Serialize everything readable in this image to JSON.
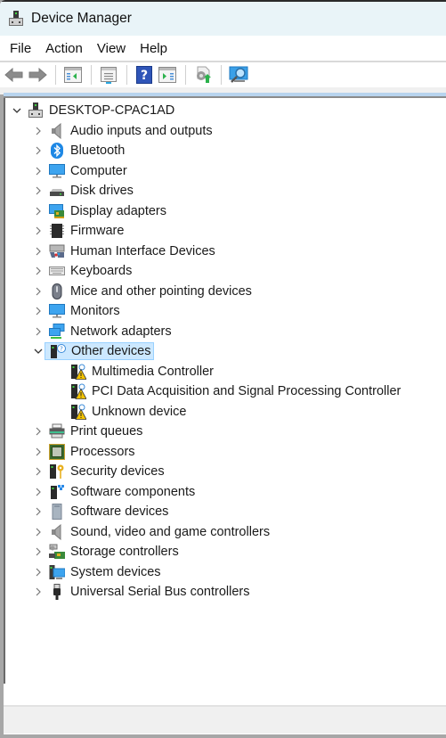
{
  "window": {
    "title": "Device Manager",
    "icon": "device-manager-icon"
  },
  "menu": [
    "File",
    "Action",
    "View",
    "Help"
  ],
  "toolbar": [
    {
      "name": "back-button",
      "icon": "arrow-left-icon"
    },
    {
      "name": "forward-button",
      "icon": "arrow-right-icon"
    },
    {
      "name": "show-hide-console-tree-button",
      "icon": "console-tree-icon"
    },
    {
      "name": "properties-button",
      "icon": "properties-icon"
    },
    {
      "name": "help-button",
      "icon": "help-icon"
    },
    {
      "name": "show-hide-action-pane-button",
      "icon": "action-pane-icon"
    },
    {
      "name": "update-driver-button",
      "icon": "update-driver-icon"
    },
    {
      "name": "scan-hardware-changes-button",
      "icon": "scan-hardware-icon"
    }
  ],
  "tree": {
    "root": {
      "label": "DESKTOP-CPAC1AD",
      "expanded": true,
      "icon": "computer-tower-icon"
    },
    "categories": [
      {
        "label": "Audio inputs and outputs",
        "icon": "speaker-icon",
        "expanded": false
      },
      {
        "label": "Bluetooth",
        "icon": "bluetooth-icon",
        "expanded": false
      },
      {
        "label": "Computer",
        "icon": "monitor-icon",
        "expanded": false
      },
      {
        "label": "Disk drives",
        "icon": "disk-drive-icon",
        "expanded": false
      },
      {
        "label": "Display adapters",
        "icon": "display-adapter-icon",
        "expanded": false
      },
      {
        "label": "Firmware",
        "icon": "chip-icon",
        "expanded": false
      },
      {
        "label": "Human Interface Devices",
        "icon": "hid-icon",
        "expanded": false
      },
      {
        "label": "Keyboards",
        "icon": "keyboard-icon",
        "expanded": false
      },
      {
        "label": "Mice and other pointing devices",
        "icon": "mouse-icon",
        "expanded": false
      },
      {
        "label": "Monitors",
        "icon": "monitor-icon",
        "expanded": false
      },
      {
        "label": "Network adapters",
        "icon": "network-icon",
        "expanded": false
      },
      {
        "label": "Other devices",
        "icon": "unknown-device-icon",
        "expanded": true,
        "selected": true,
        "children": [
          {
            "label": "Multimedia Controller",
            "icon": "warning-device-icon"
          },
          {
            "label": "PCI Data Acquisition and Signal Processing Controller",
            "icon": "warning-device-icon"
          },
          {
            "label": "Unknown device",
            "icon": "warning-device-icon"
          }
        ]
      },
      {
        "label": "Print queues",
        "icon": "printer-icon",
        "expanded": false
      },
      {
        "label": "Processors",
        "icon": "processor-icon",
        "expanded": false
      },
      {
        "label": "Security devices",
        "icon": "security-key-icon",
        "expanded": false
      },
      {
        "label": "Software components",
        "icon": "software-component-icon",
        "expanded": false
      },
      {
        "label": "Software devices",
        "icon": "software-device-icon",
        "expanded": false
      },
      {
        "label": "Sound, video and game controllers",
        "icon": "speaker-icon",
        "expanded": false
      },
      {
        "label": "Storage controllers",
        "icon": "storage-controller-icon",
        "expanded": false
      },
      {
        "label": "System devices",
        "icon": "system-devices-icon",
        "expanded": false
      },
      {
        "label": "Universal Serial Bus controllers",
        "icon": "usb-icon",
        "expanded": false
      }
    ]
  },
  "colors": {
    "titlebar_bg": "#e9f4f8",
    "selection_bg": "#cce8ff",
    "selection_border": "#99d1ff",
    "warning": "#f5c400",
    "accent_blue": "#1e88e5"
  }
}
